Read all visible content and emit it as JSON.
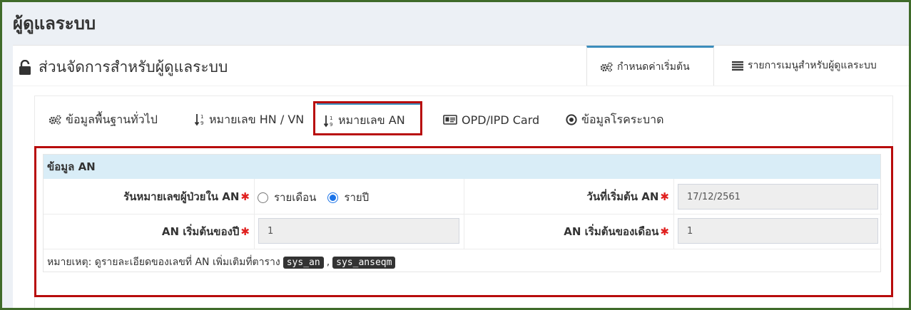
{
  "page": {
    "title": "ผู้ดูแลระบบ"
  },
  "panel": {
    "title": "ส่วนจัดการสำหรับผู้ดูแลระบบ",
    "tabs": [
      {
        "label": "กำหนดค่าเริ่มต้น",
        "icon": "gears-icon",
        "active": true
      },
      {
        "label": "รายการเมนูสำหรับผู้ดูแลระบบ",
        "icon": "list-icon",
        "active": false
      }
    ]
  },
  "subtabs": [
    {
      "label": "ข้อมูลพื้นฐานทั่วไป",
      "icon": "gears-icon"
    },
    {
      "label": "หมายเลข HN / VN",
      "icon": "sort-numeric-icon"
    },
    {
      "label": "หมายเลข AN",
      "icon": "sort-numeric-icon",
      "active": true
    },
    {
      "label": "OPD/IPD Card",
      "icon": "id-card-icon"
    },
    {
      "label": "ข้อมูลโรคระบาด",
      "icon": "dot-circle-icon"
    }
  ],
  "form": {
    "heading": "ข้อมูล AN",
    "run_label": "รันหมายเลขผู้ป่วยใน AN",
    "run_options": [
      "รายเดือน",
      "รายปี"
    ],
    "run_selected": "รายปี",
    "start_date_label": "วันที่เริ่มต้น AN",
    "start_date_value": "17/12/2561",
    "year_start_label": "AN เริ่มต้นของปี",
    "year_start_value": "1",
    "month_start_label": "AN เริ่มต้นของเดือน",
    "month_start_value": "1",
    "required_mark": "✱",
    "note_text": "หมายเหตุ: ดูรายละเอียดของเลขที่ AN เพิ่มเติมที่ตาราง",
    "note_tables": [
      "sys_an",
      "sys_anseqm"
    ],
    "note_sep": ","
  },
  "colors": {
    "highlight": "#b80c0c",
    "accent": "#3c8dbc",
    "head_bg": "#d9edf7",
    "required": "#e0201f"
  }
}
